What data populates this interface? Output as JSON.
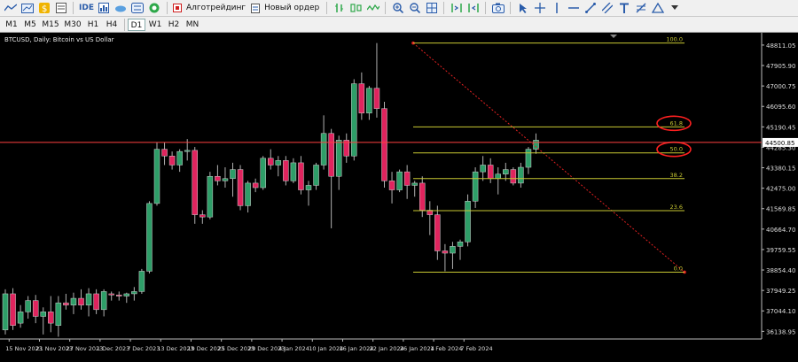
{
  "toolbar": {
    "algo_trading_label": "Алготрейдинг",
    "new_order_label": "Новый ордер",
    "ide_label": "IDE"
  },
  "timeframes": [
    "M1",
    "M5",
    "M15",
    "M30",
    "H1",
    "H4",
    "D1",
    "W1",
    "H2",
    "MN"
  ],
  "active_timeframe": "D1",
  "chart": {
    "title": "BTCUSD, Daily:  Bitcoin vs US Dollar",
    "current_price_label": "44500.85",
    "price_line_color": "#ff4040",
    "bull_color": "#2e9e68",
    "bear_color": "#e0245e",
    "price_ticks": [
      "48811.05",
      "47905.90",
      "47000.75",
      "46095.60",
      "45190.45",
      "44285.30",
      "43380.15",
      "42475.00",
      "41569.85",
      "40664.70",
      "39759.55",
      "38854.40",
      "37949.25",
      "37044.10",
      "36138.95"
    ],
    "date_ticks": [
      "15 Nov 2023",
      "21 Nov 2023",
      "27 Nov 2023",
      "1 Dec 2023",
      "7 Dec 2023",
      "13 Dec 2023",
      "19 Dec 2023",
      "25 Dec 2023",
      "29 Dec 2023",
      "4 Jan 2024",
      "10 Jan 2024",
      "16 Jan 2024",
      "22 Jan 2024",
      "26 Jan 2024",
      "1 Feb 2024",
      "7 Feb 2024"
    ],
    "fib_levels": [
      {
        "label": "100.0",
        "price": 48900
      },
      {
        "label": "61.8",
        "price": 45190
      },
      {
        "label": "50.0",
        "price": 44040
      },
      {
        "label": "38.2",
        "price": 42900
      },
      {
        "label": "23.6",
        "price": 41480
      },
      {
        "label": "0.0",
        "price": 38760
      }
    ],
    "fib_highlight": [
      "61.8",
      "50.0"
    ],
    "fib_color": "#c8c832",
    "highlight_color": "#ff2020"
  },
  "chart_data": {
    "type": "candlestick",
    "title": "BTCUSD, Daily:  Bitcoin vs US Dollar",
    "ylim": [
      35800,
      49200
    ],
    "current_price": 44500.85,
    "candles": [
      {
        "o": 36200,
        "h": 38000,
        "l": 36000,
        "c": 37800
      },
      {
        "o": 37800,
        "h": 38050,
        "l": 36200,
        "c": 36400
      },
      {
        "o": 36500,
        "h": 37300,
        "l": 36300,
        "c": 37000
      },
      {
        "o": 37000,
        "h": 37700,
        "l": 36700,
        "c": 37500
      },
      {
        "o": 37500,
        "h": 37750,
        "l": 36500,
        "c": 36800
      },
      {
        "o": 36800,
        "h": 37200,
        "l": 36000,
        "c": 37000
      },
      {
        "o": 37000,
        "h": 37700,
        "l": 36100,
        "c": 36500
      },
      {
        "o": 36400,
        "h": 37700,
        "l": 35900,
        "c": 37400
      },
      {
        "o": 37400,
        "h": 37800,
        "l": 37100,
        "c": 37300
      },
      {
        "o": 37300,
        "h": 37850,
        "l": 36900,
        "c": 37600
      },
      {
        "o": 37600,
        "h": 38000,
        "l": 37100,
        "c": 37300
      },
      {
        "o": 37300,
        "h": 38050,
        "l": 36800,
        "c": 37800
      },
      {
        "o": 37800,
        "h": 38000,
        "l": 36900,
        "c": 37100
      },
      {
        "o": 37100,
        "h": 38000,
        "l": 36800,
        "c": 37900
      },
      {
        "o": 37800,
        "h": 37900,
        "l": 37500,
        "c": 37750
      },
      {
        "o": 37750,
        "h": 37900,
        "l": 37500,
        "c": 37700
      },
      {
        "o": 37700,
        "h": 37850,
        "l": 37400,
        "c": 37800
      },
      {
        "o": 37800,
        "h": 38100,
        "l": 37500,
        "c": 37900
      },
      {
        "o": 37900,
        "h": 38900,
        "l": 37800,
        "c": 38800
      },
      {
        "o": 38800,
        "h": 41900,
        "l": 38700,
        "c": 41800
      },
      {
        "o": 41800,
        "h": 44500,
        "l": 41700,
        "c": 44200
      },
      {
        "o": 44200,
        "h": 44500,
        "l": 43500,
        "c": 43900
      },
      {
        "o": 43900,
        "h": 44100,
        "l": 43300,
        "c": 43500
      },
      {
        "o": 43500,
        "h": 44200,
        "l": 43200,
        "c": 44100
      },
      {
        "o": 44100,
        "h": 44650,
        "l": 43700,
        "c": 44150
      },
      {
        "o": 44150,
        "h": 44300,
        "l": 40900,
        "c": 41300
      },
      {
        "o": 41300,
        "h": 41500,
        "l": 40900,
        "c": 41200
      },
      {
        "o": 41200,
        "h": 43200,
        "l": 41100,
        "c": 43000
      },
      {
        "o": 43000,
        "h": 43500,
        "l": 42600,
        "c": 42800
      },
      {
        "o": 42800,
        "h": 43400,
        "l": 42500,
        "c": 42900
      },
      {
        "o": 42900,
        "h": 43600,
        "l": 42100,
        "c": 43300
      },
      {
        "o": 43300,
        "h": 43500,
        "l": 41500,
        "c": 41700
      },
      {
        "o": 41700,
        "h": 42800,
        "l": 41400,
        "c": 42700
      },
      {
        "o": 42700,
        "h": 42900,
        "l": 42300,
        "c": 42500
      },
      {
        "o": 42500,
        "h": 43900,
        "l": 42400,
        "c": 43800
      },
      {
        "o": 43800,
        "h": 44200,
        "l": 43300,
        "c": 43500
      },
      {
        "o": 43500,
        "h": 43900,
        "l": 43000,
        "c": 43700
      },
      {
        "o": 43700,
        "h": 43900,
        "l": 42600,
        "c": 42800
      },
      {
        "o": 42800,
        "h": 43800,
        "l": 42700,
        "c": 43600
      },
      {
        "o": 43600,
        "h": 43900,
        "l": 42200,
        "c": 42400
      },
      {
        "o": 42400,
        "h": 42800,
        "l": 41700,
        "c": 42600
      },
      {
        "o": 42600,
        "h": 43600,
        "l": 42400,
        "c": 43500
      },
      {
        "o": 43500,
        "h": 45700,
        "l": 43300,
        "c": 44900
      },
      {
        "o": 44900,
        "h": 45100,
        "l": 40700,
        "c": 43000
      },
      {
        "o": 43000,
        "h": 44800,
        "l": 42400,
        "c": 44600
      },
      {
        "o": 44600,
        "h": 44900,
        "l": 43600,
        "c": 43900
      },
      {
        "o": 43900,
        "h": 47300,
        "l": 43700,
        "c": 47100
      },
      {
        "o": 47100,
        "h": 47600,
        "l": 45500,
        "c": 45800
      },
      {
        "o": 45800,
        "h": 47000,
        "l": 45500,
        "c": 46900
      },
      {
        "o": 46900,
        "h": 48900,
        "l": 45600,
        "c": 46000
      },
      {
        "o": 46000,
        "h": 46300,
        "l": 42500,
        "c": 42800
      },
      {
        "o": 42800,
        "h": 43200,
        "l": 41800,
        "c": 42400
      },
      {
        "o": 42400,
        "h": 43300,
        "l": 42300,
        "c": 43200
      },
      {
        "o": 43200,
        "h": 43500,
        "l": 42000,
        "c": 42600
      },
      {
        "o": 42600,
        "h": 42800,
        "l": 42100,
        "c": 42700
      },
      {
        "o": 42700,
        "h": 43000,
        "l": 41200,
        "c": 41500
      },
      {
        "o": 41500,
        "h": 41900,
        "l": 40400,
        "c": 41300
      },
      {
        "o": 41300,
        "h": 41700,
        "l": 39300,
        "c": 39700
      },
      {
        "o": 39700,
        "h": 40000,
        "l": 38800,
        "c": 39600
      },
      {
        "o": 39600,
        "h": 40100,
        "l": 38900,
        "c": 39900
      },
      {
        "o": 39900,
        "h": 40200,
        "l": 39300,
        "c": 40100
      },
      {
        "o": 40100,
        "h": 42200,
        "l": 39900,
        "c": 41900
      },
      {
        "o": 41900,
        "h": 43400,
        "l": 41600,
        "c": 43200
      },
      {
        "o": 43200,
        "h": 43900,
        "l": 42800,
        "c": 43500
      },
      {
        "o": 43500,
        "h": 43800,
        "l": 42700,
        "c": 42900
      },
      {
        "o": 42900,
        "h": 43400,
        "l": 42200,
        "c": 43100
      },
      {
        "o": 43100,
        "h": 43600,
        "l": 42800,
        "c": 43300
      },
      {
        "o": 43300,
        "h": 43400,
        "l": 42600,
        "c": 42700
      },
      {
        "o": 42700,
        "h": 43600,
        "l": 42500,
        "c": 43400
      },
      {
        "o": 43400,
        "h": 44300,
        "l": 43100,
        "c": 44200
      },
      {
        "o": 44200,
        "h": 44900,
        "l": 44000,
        "c": 44600
      }
    ]
  }
}
